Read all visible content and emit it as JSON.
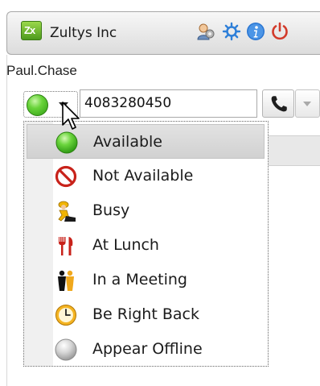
{
  "window": {
    "app_title": "Zultys Inc",
    "logo_text": "Zx",
    "toolbar_icons": [
      "contacts-icon",
      "settings-gear-icon",
      "info-icon",
      "power-icon"
    ]
  },
  "user": {
    "name": "Paul.Chase"
  },
  "presence": {
    "current_status": "Available",
    "current_icon": "green-status-icon"
  },
  "dial": {
    "number": "4083280450",
    "call_icon": "phone-handset-icon"
  },
  "status_menu": {
    "items": [
      {
        "label": "Available",
        "icon": "green-status-icon",
        "selected": true
      },
      {
        "label": "Not Available",
        "icon": "not-available-icon",
        "selected": false
      },
      {
        "label": "Busy",
        "icon": "busy-worker-icon",
        "selected": false
      },
      {
        "label": "At Lunch",
        "icon": "fork-knife-icon",
        "selected": false
      },
      {
        "label": "In a Meeting",
        "icon": "meeting-people-icon",
        "selected": false
      },
      {
        "label": "Be Right Back",
        "icon": "clock-icon",
        "selected": false
      },
      {
        "label": "Appear Offline",
        "icon": "offline-status-icon",
        "selected": false
      }
    ]
  },
  "colors": {
    "available_green": "#4fbe26",
    "not_available_red": "#c8221a",
    "settings_blue": "#2e7fd8",
    "power_red": "#d23a2a",
    "clock_orange": "#f0a81c"
  }
}
